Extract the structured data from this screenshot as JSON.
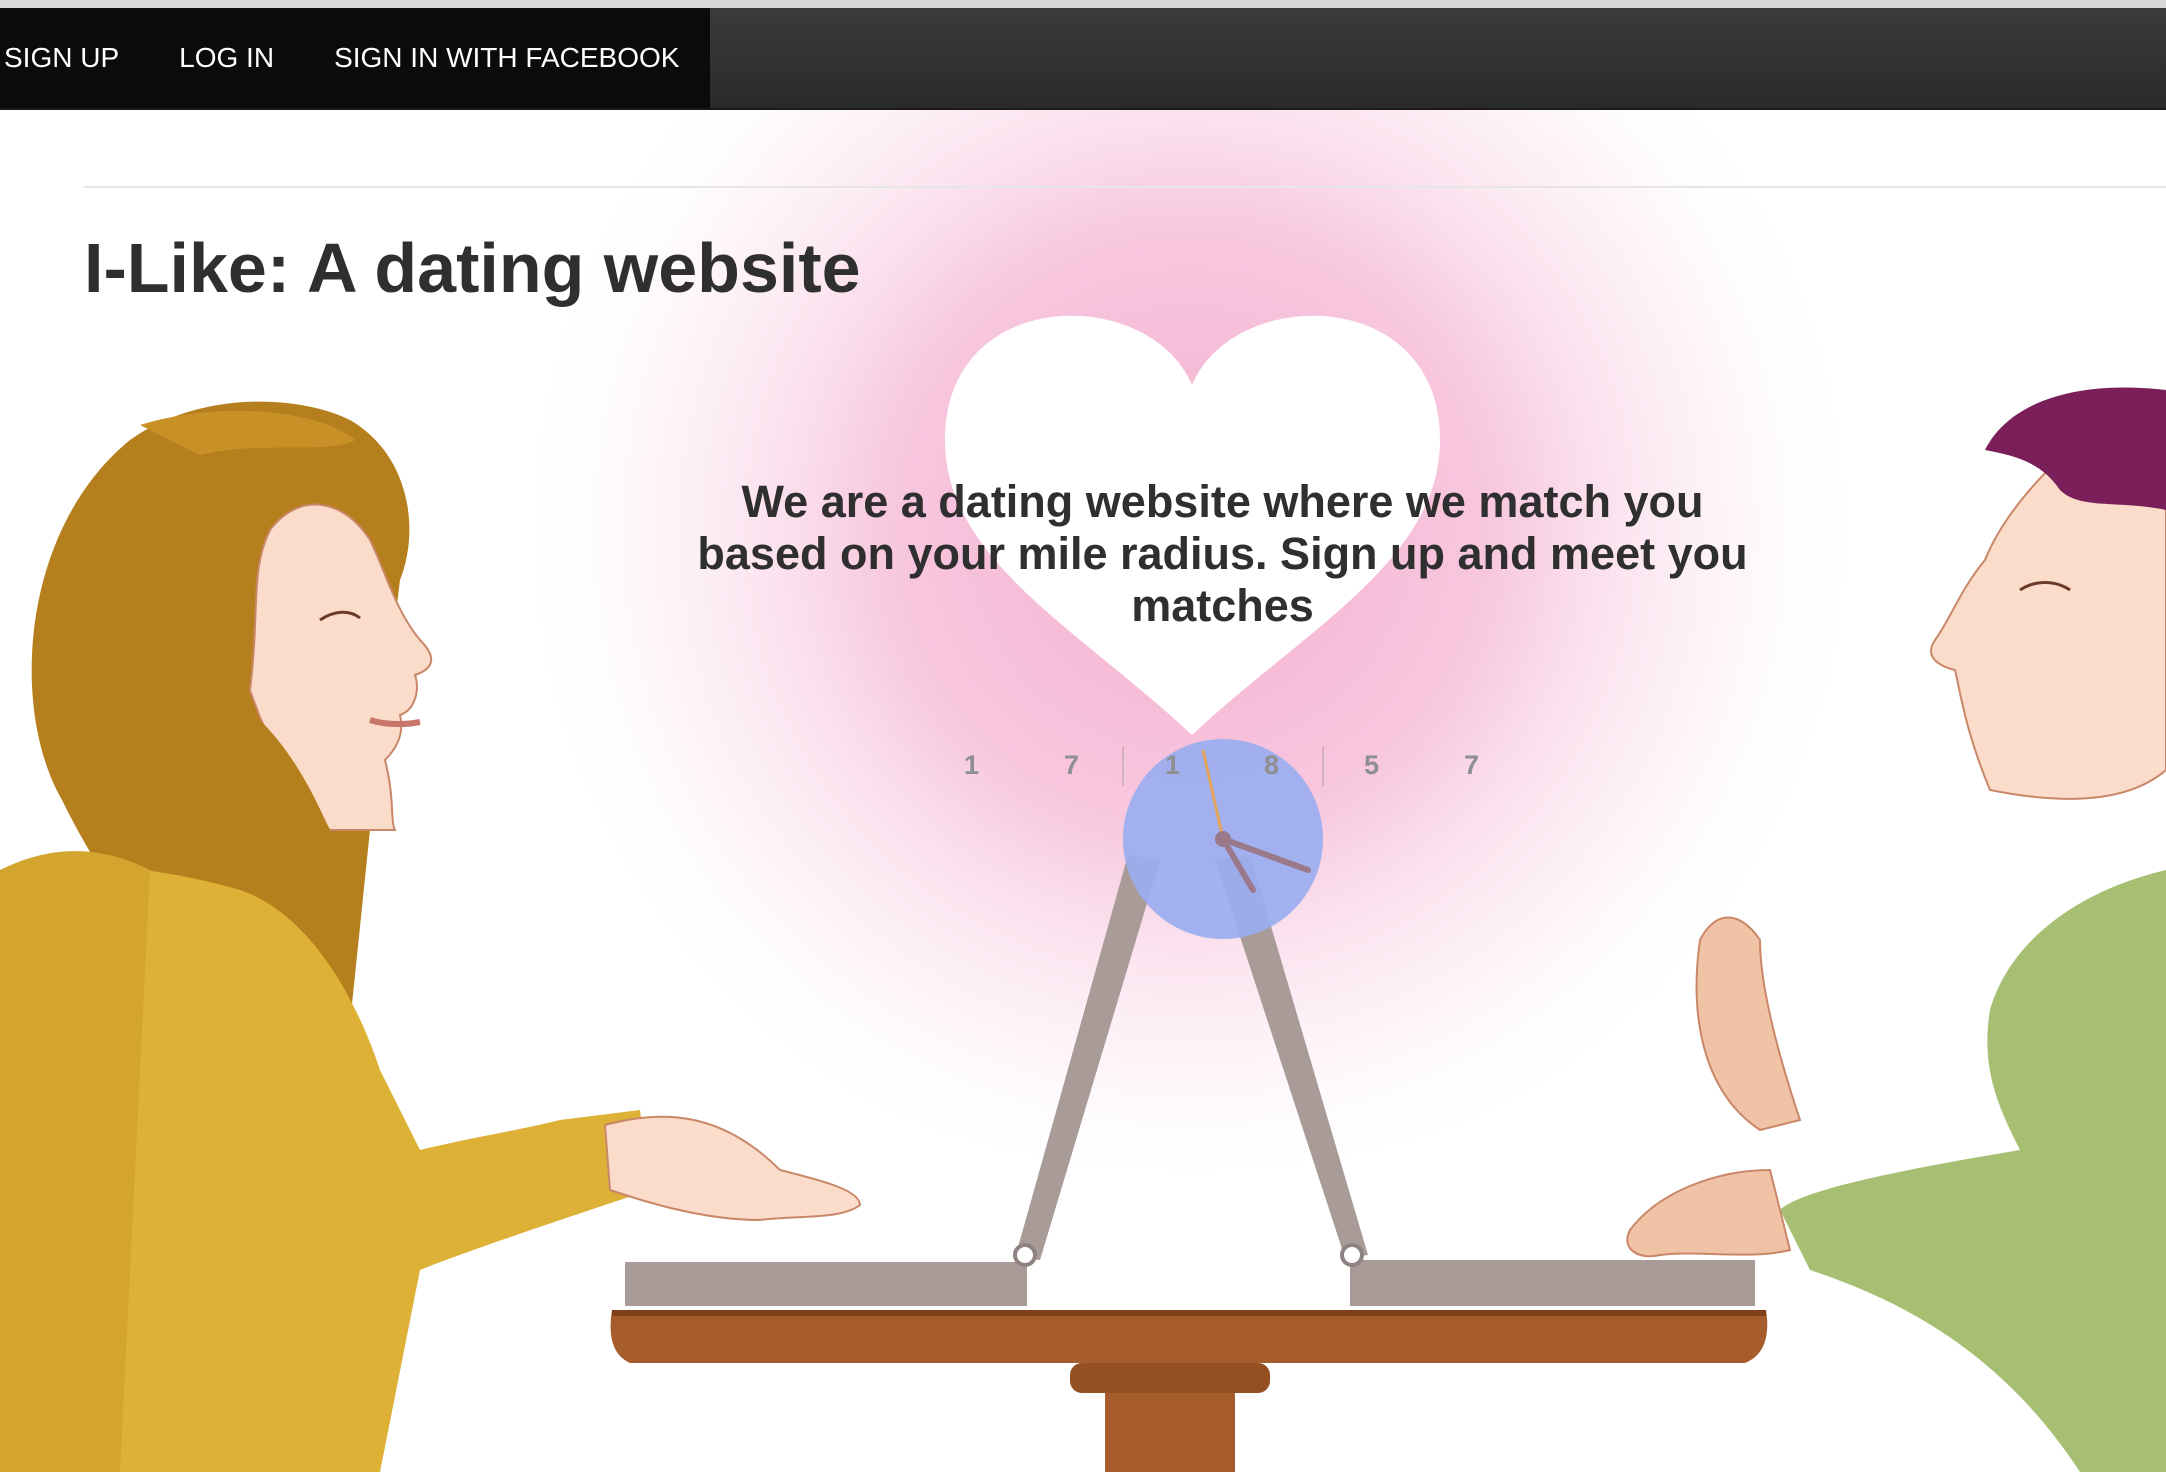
{
  "nav": {
    "sign_up": "SIGN UP",
    "log_in": "LOG IN",
    "facebook": "SIGN IN WITH FACEBOOK"
  },
  "hero": {
    "title": "I-Like: A dating website",
    "tagline": "We are a dating website where we match you based on your mile radius. Sign up and meet you matches"
  },
  "clock": {
    "digits": [
      "1",
      "7",
      "1",
      "8",
      "5",
      "7"
    ]
  },
  "colors": {
    "navbar": "#2f2f2f",
    "nav_active": "#0b0b0b",
    "pink_glow": "#f3a8cc",
    "title_text": "#2f2f2f",
    "clock_face": "#9aaef0"
  }
}
